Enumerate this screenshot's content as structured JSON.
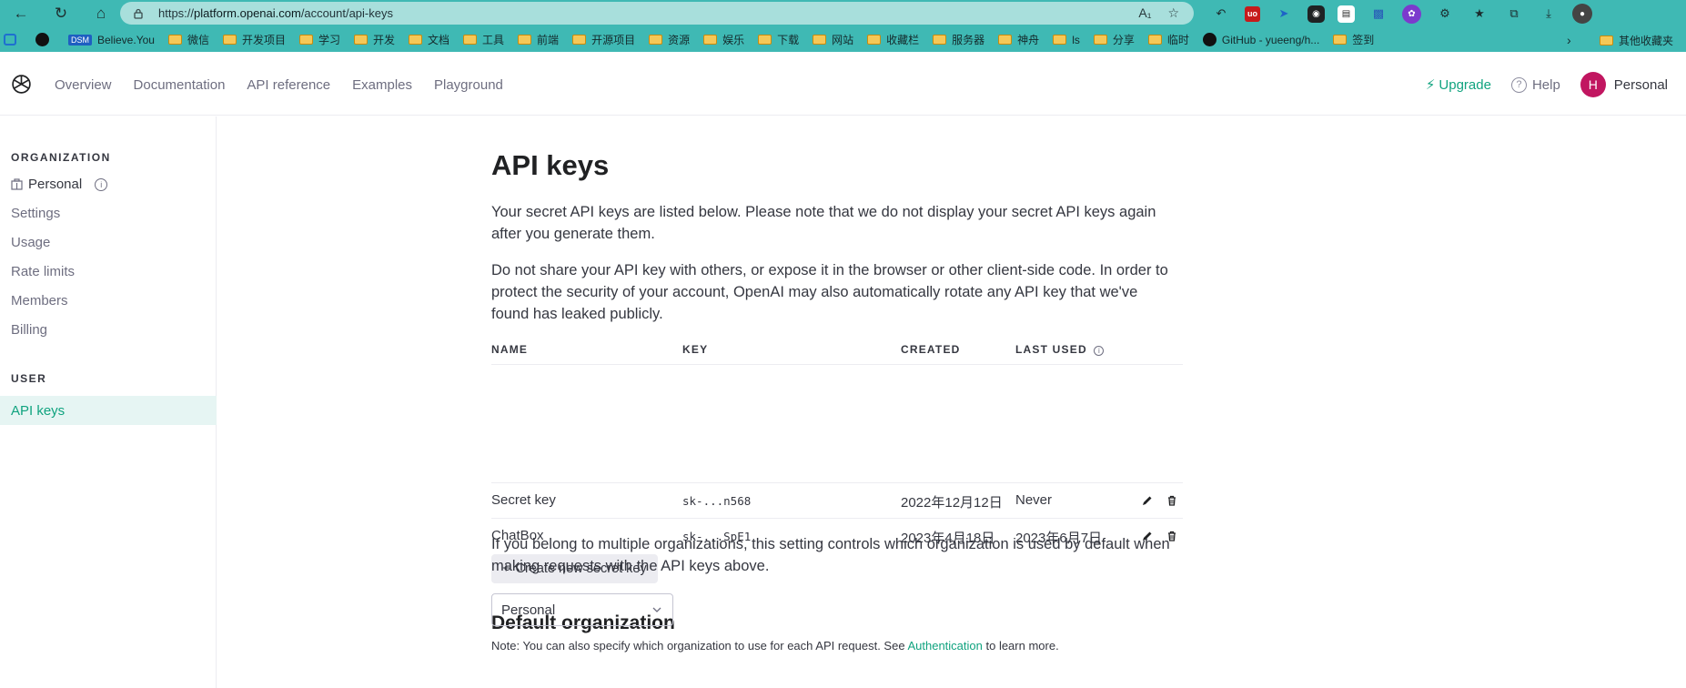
{
  "browser": {
    "url_prefix": "https://",
    "url_host": "platform.openai.com",
    "url_path": "/account/api-keys",
    "bookmarks": [
      "Believe.You",
      "微信",
      "开发项目",
      "学习",
      "开发",
      "文档",
      "工具",
      "前端",
      "开源项目",
      "资源",
      "娱乐",
      "下载",
      "网站",
      "收藏栏",
      "服务器",
      "神舟",
      "ls",
      "分享",
      "临时",
      "GitHub - yueeng/h...",
      "签到"
    ],
    "other_bookmarks": "其他收藏夹",
    "ext_labels": {
      "ublock": "uo",
      "dark": "◉",
      "white": "▤"
    }
  },
  "header": {
    "nav": [
      "Overview",
      "Documentation",
      "API reference",
      "Examples",
      "Playground"
    ],
    "upgrade": "Upgrade",
    "help": "Help",
    "user_initial": "H",
    "user_name": "Personal"
  },
  "sidebar": {
    "org_section": "ORGANIZATION",
    "org_name": "Personal",
    "org_items": [
      "Settings",
      "Usage",
      "Rate limits",
      "Members",
      "Billing"
    ],
    "user_section": "USER",
    "active_item": "API keys"
  },
  "main": {
    "title": "API keys",
    "para1": "Your secret API keys are listed below. Please note that we do not display your secret API keys again after you generate them.",
    "para2": "Do not share your API key with others, or expose it in the browser or other client-side code. In order to protect the security of your account, OpenAI may also automatically rotate any API key that we've found has leaked publicly.",
    "columns": [
      "NAME",
      "KEY",
      "CREATED",
      "LAST USED"
    ],
    "rows": [
      {
        "name": "Secret key",
        "key": "sk-...n568",
        "created": "2022年12月12日",
        "last_used": "Never"
      },
      {
        "name": "ChatBox",
        "key": "sk-...SpE1",
        "created": "2023年4月18日",
        "last_used": "2023年6月7日"
      }
    ],
    "create_button": "Create new secret key",
    "default_org_title": "Default organization",
    "default_org_desc": "If you belong to multiple organizations, this setting controls which organization is used by default when making requests with the API keys above.",
    "org_select_value": "Personal",
    "note_prefix": "Note: You can also specify which organization to use for each API request. See ",
    "note_link": "Authentication",
    "note_suffix": " to learn more."
  },
  "colors": {
    "accent": "#10a37f",
    "browser_bar": "#3fb9b4",
    "avatar": "#c11660"
  }
}
